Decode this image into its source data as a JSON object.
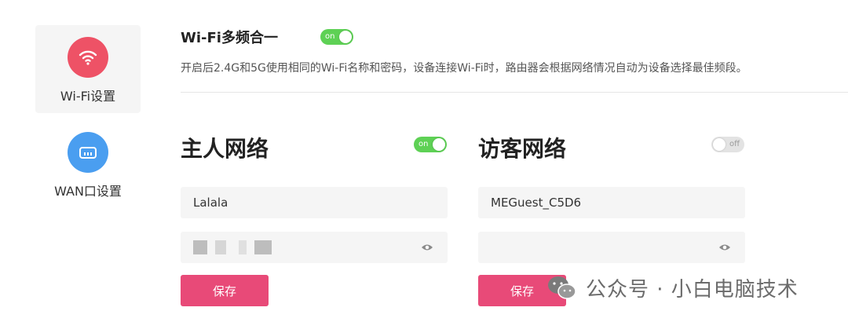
{
  "sidebar": {
    "items": [
      {
        "label": "Wi-Fi设置",
        "icon": "wifi-icon",
        "color": "#ee5266"
      },
      {
        "label": "WAN口设置",
        "icon": "router-icon",
        "color": "#4a9ef0"
      }
    ]
  },
  "multiband": {
    "title": "Wi-Fi多频合一",
    "toggle_label": "on",
    "description": "开启后2.4G和5G使用相同的Wi-Fi名称和密码，设备连接Wi-Fi时，路由器会根据网络情况自动为设备选择最佳频段。"
  },
  "host_network": {
    "title": "主人网络",
    "toggle_label": "on",
    "ssid": "Lalala",
    "save_label": "保存"
  },
  "guest_network": {
    "title": "访客网络",
    "toggle_label": "off",
    "ssid": "MEGuest_C5D6",
    "save_label": "保存"
  },
  "watermark": {
    "text": "公众号 · 小白电脑技术"
  },
  "colors": {
    "accent": "#e84a78",
    "toggle_on": "#5ed155",
    "toggle_off": "#e3e3e3"
  }
}
